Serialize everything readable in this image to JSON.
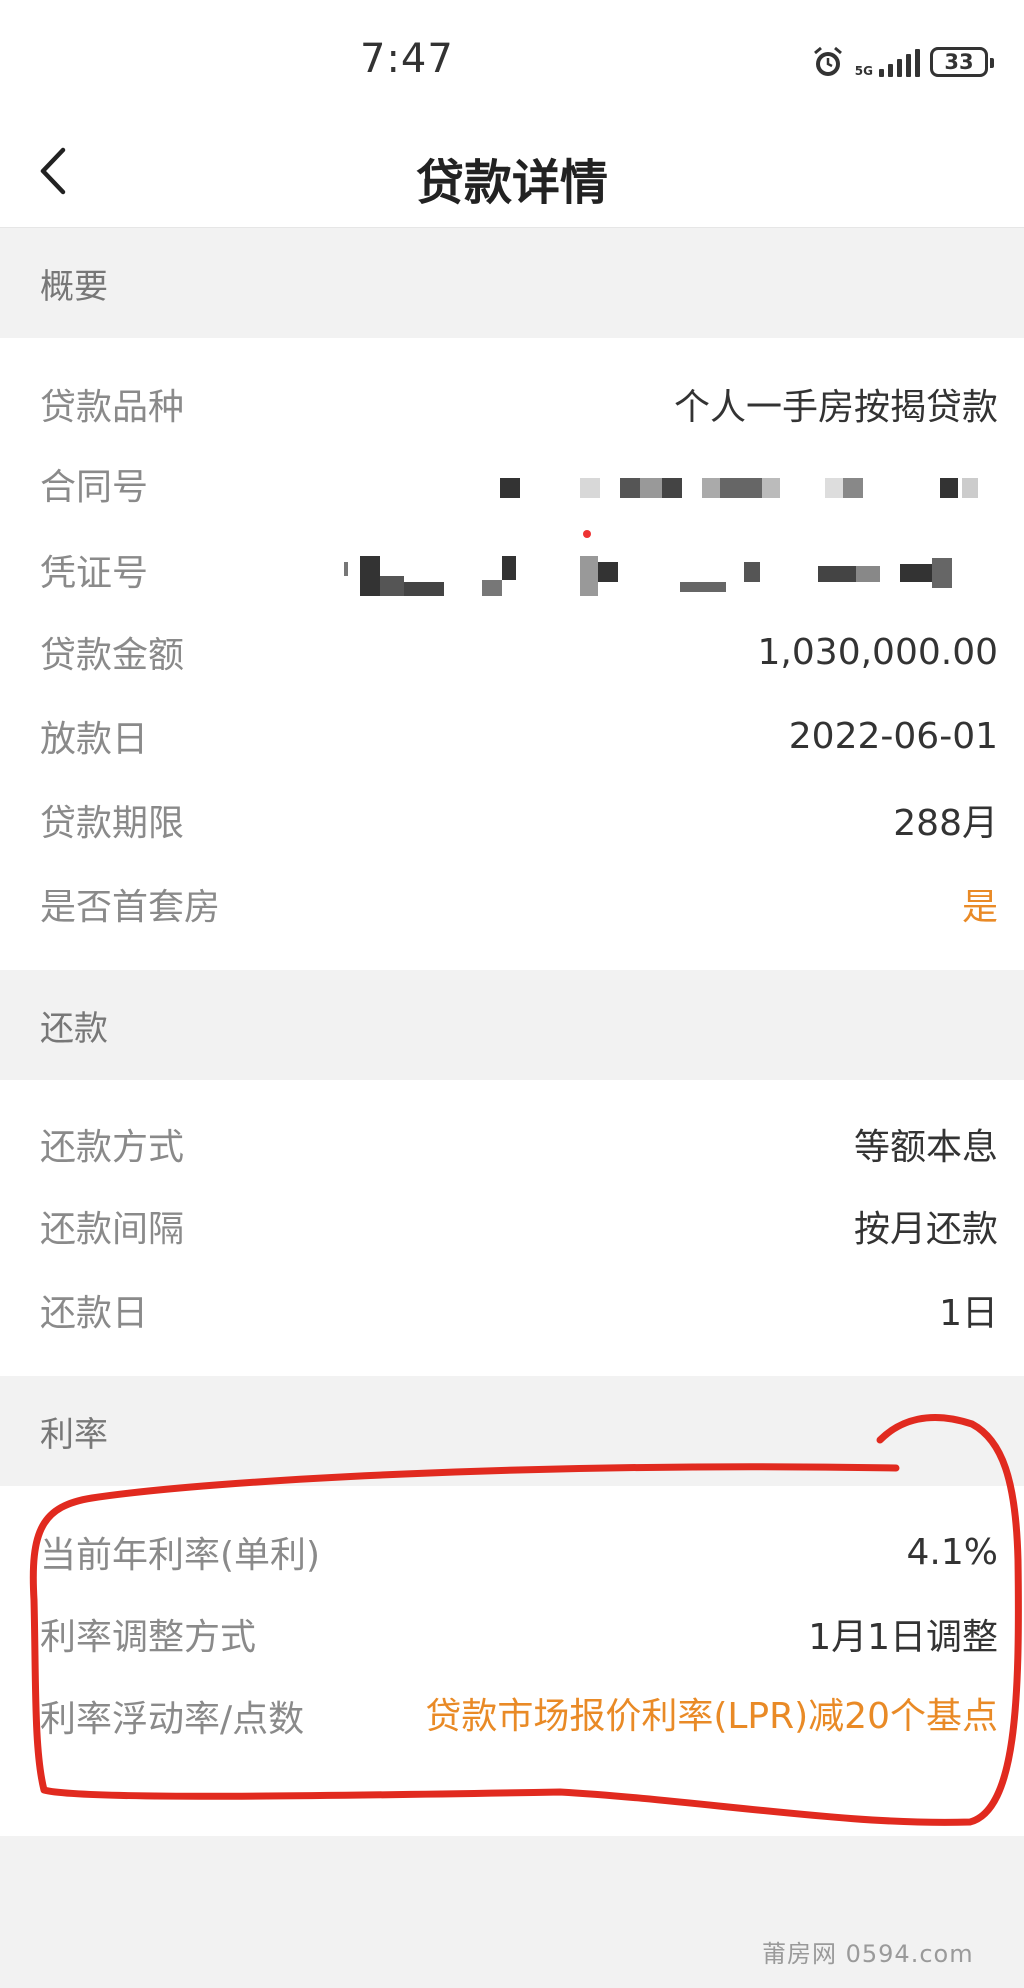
{
  "status_bar": {
    "time": "7:47",
    "network": "5G",
    "battery": "33",
    "icons": [
      "alarm-icon",
      "signal-icon",
      "battery-icon"
    ]
  },
  "nav": {
    "title": "贷款详情",
    "back_icon": "chevron-left-icon"
  },
  "overview": {
    "header": "概要",
    "rows": [
      {
        "label": "贷款品种",
        "value": "个人一手房按揭贷款"
      },
      {
        "label": "合同号",
        "value": ""
      },
      {
        "label": "凭证号",
        "value": ""
      },
      {
        "label": "贷款金额",
        "value": "1,030,000.00"
      },
      {
        "label": "放款日",
        "value": "2022-06-01"
      },
      {
        "label": "贷款期限",
        "value": "288月"
      },
      {
        "label": "是否首套房",
        "value": "是"
      }
    ]
  },
  "repayment": {
    "header": "还款",
    "rows": [
      {
        "label": "还款方式",
        "value": "等额本息"
      },
      {
        "label": "还款间隔",
        "value": "按月还款"
      },
      {
        "label": "还款日",
        "value": "1日"
      }
    ]
  },
  "interest": {
    "header": "利率",
    "rows": [
      {
        "label": "当前年利率(单利)",
        "value": "4.1%"
      },
      {
        "label": "利率调整方式",
        "value": "1月1日调整"
      },
      {
        "label": "利率浮动率/点数",
        "value": "贷款市场报价利率(LPR)减20个基点"
      }
    ]
  },
  "watermark": "莆房网 0594.com",
  "colors": {
    "accent_orange": "#e98a26",
    "annotation_red": "#e12a1f",
    "page_bg": "#f2f2f2",
    "label_gray": "#8a8a8a"
  }
}
